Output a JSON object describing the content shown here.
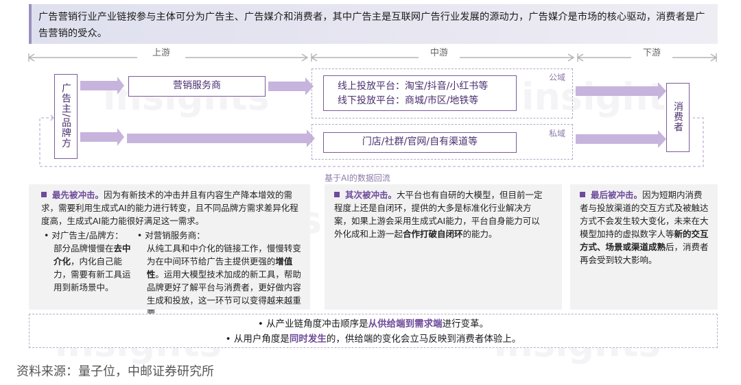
{
  "banner": "广告营销行业产业链按参与主体可分为广告主、广告媒介和消费者，其中广告主是互联网广告行业发展的源动力，广告媒介是市场的核心驱动，消费者是广告营销的受众。",
  "stages": {
    "upstream": "上游",
    "midstream": "中游",
    "downstream": "下游"
  },
  "advertiser": "广告主/品牌方",
  "marketing_provider": "营销服务商",
  "public_domain": {
    "tag": "公域",
    "line1": "线上投放平台：淘宝/抖音/小红书等",
    "line2": "线下投放平台：商城/市区/地铁等"
  },
  "private_domain": {
    "tag": "私域",
    "line1": "门店/社群/官网/自有渠道等"
  },
  "consumer": "消费者",
  "feedback": "基于AI的数据回流",
  "panel_left": {
    "title": "最先被冲击。",
    "para": "因为有新技术的冲击并且有内容生产降本增效的需求，需要利用生成式AI的能力进行转变，且不同品牌方需求差异化程度高，生成式AI能力能很好满足这一需求。",
    "sub1_head": "对广告主/品牌方：",
    "sub1_pre": "部分品牌慢慢在",
    "sub1_bold": "去中介化",
    "sub1_post": "，内化自己能力，需要有新工具运用到新场景中。",
    "sub2_head": "对营销服务商：",
    "sub2_pre": "从纯工具和中介化的链接工作，慢慢转变为在中间环节给广告主提供更强的",
    "sub2_bold": "增值性",
    "sub2_post": "。运用大模型技术加成的新工具，帮助品牌更好了解平台与消费者，更好做内容生成和投放，这一环节可以变得越来越重要。"
  },
  "panel_mid": {
    "title": "其次被冲击。",
    "pre": "大平台也有自研的大模型，但目前一定程度上还是自闭环，提供的大多是标准化行业解决方案，如果上游会采用生成式AI能力，平台自身能力可以外化成和上游一起",
    "bold": "合作打破自闭环",
    "post": "的能力。"
  },
  "panel_right": {
    "title": "最后被冲击。",
    "pre": "因为短期内消费者与投放渠道的交互方式及被触达方式不会发生较大变化，未来在大模型加持的虚拟数字人等",
    "bold": "新的交互方式、场景或渠道成熟",
    "post": "后，消费者再会受到较大影响。"
  },
  "summary": {
    "l1_pre": "从产业链角度冲击顺序是",
    "l1_hl": "从供给端到需求端",
    "l1_post": "进行变革。",
    "l2_pre": "从用户角度是",
    "l2_hl": "同时发生",
    "l2_post": "的，供给端的变化会立马反映到消费者体验上。"
  },
  "source": "资料来源：量子位，中邮证券研究所",
  "watermark": "insights",
  "colors": {
    "accent": "#6e4b9a",
    "box_border": "#7a5a9a",
    "arrow": "#c6b4dd"
  }
}
